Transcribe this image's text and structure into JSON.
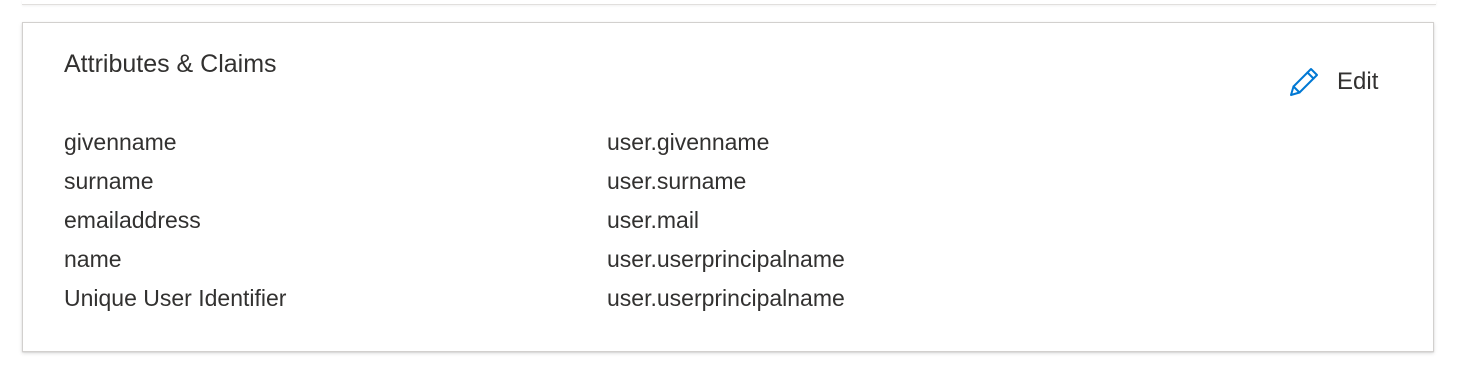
{
  "card": {
    "title": "Attributes & Claims",
    "edit_label": "Edit",
    "edit_icon": "pencil-icon"
  },
  "claims": [
    {
      "name": "givenname",
      "value": "user.givenname"
    },
    {
      "name": "surname",
      "value": "user.surname"
    },
    {
      "name": "emailaddress",
      "value": "user.mail"
    },
    {
      "name": "name",
      "value": "user.userprincipalname"
    },
    {
      "name": "Unique User Identifier",
      "value": "user.userprincipalname"
    }
  ],
  "colors": {
    "accent": "#0078d4",
    "text": "#323130",
    "border": "#d2d0ce"
  }
}
